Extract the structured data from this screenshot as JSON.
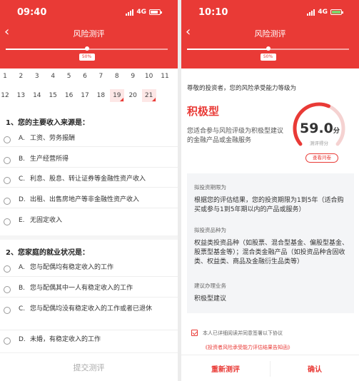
{
  "left": {
    "status": {
      "time": "09:40",
      "network": "4G"
    },
    "nav": {
      "back_label": "‹",
      "title": "风险测评"
    },
    "progress": {
      "percent": 50,
      "label": "50%"
    },
    "question_numbers": [
      {
        "n": "1",
        "answered": false
      },
      {
        "n": "2",
        "answered": false
      },
      {
        "n": "3",
        "answered": false
      },
      {
        "n": "4",
        "answered": false
      },
      {
        "n": "5",
        "answered": false
      },
      {
        "n": "6",
        "answered": false
      },
      {
        "n": "7",
        "answered": false
      },
      {
        "n": "8",
        "answered": false
      },
      {
        "n": "9",
        "answered": false
      },
      {
        "n": "10",
        "answered": false
      },
      {
        "n": "11",
        "answered": false
      },
      {
        "n": "12",
        "answered": false
      },
      {
        "n": "13",
        "answered": false
      },
      {
        "n": "14",
        "answered": false
      },
      {
        "n": "15",
        "answered": false
      },
      {
        "n": "16",
        "answered": false
      },
      {
        "n": "17",
        "answered": false
      },
      {
        "n": "18",
        "answered": false
      },
      {
        "n": "19",
        "answered": true
      },
      {
        "n": "20",
        "answered": false
      },
      {
        "n": "21",
        "answered": true
      }
    ],
    "questions": [
      {
        "title": "1、您的主要收入来源是：",
        "options": [
          {
            "letter": "A.",
            "text": "工资、劳务报酬"
          },
          {
            "letter": "B.",
            "text": "生产经营所得"
          },
          {
            "letter": "C.",
            "text": "利息、股息、转让证券等金融性资产收入"
          },
          {
            "letter": "D.",
            "text": "出租、出售房地产等非金融性资产收入"
          },
          {
            "letter": "E.",
            "text": "无固定收入"
          }
        ]
      },
      {
        "title": "2、您家庭的就业状况是：",
        "options": [
          {
            "letter": "A.",
            "text": "您与配偶均有稳定收入的工作"
          },
          {
            "letter": "B.",
            "text": "您与配偶其中一人有稳定收入的工作"
          },
          {
            "letter": "C.",
            "text": "您与配偶均没有稳定收入的工作或者已退休"
          },
          {
            "letter": "D.",
            "text": "未婚，有稳定收入的工作"
          }
        ]
      }
    ],
    "submit_label": "提交测评"
  },
  "right": {
    "status": {
      "time": "10:10",
      "network": "4G"
    },
    "nav": {
      "back_label": "‹",
      "title": "风险测评"
    },
    "progress": {
      "percent": 50,
      "label": "50%"
    },
    "greeting": "尊敬的投资者，您的风险承受能力等级为",
    "level": "积极型",
    "suitable_text": "您适合参与风险评级为积极型建议的金融产品或金融服务",
    "score": {
      "value": "59.0",
      "unit": "分",
      "label": "测评得分",
      "max": 100
    },
    "review_label": "查看问卷",
    "details": {
      "term_label": "拟投资期限为",
      "term_value": "根据您的评估结果，您的投资期限为1到5年（适合购买或参与1到5年期以内的产品或服务）",
      "type_label": "拟投资品种为",
      "type_value": "权益类投资品种（如股票、混合型基金、偏股型基金、股票型基金等）；混合类金融产品（如投资品种含固收类、权益类、商品及金融衍生品类等）",
      "service_label": "建议办理业务",
      "service_value": "积极型建议"
    },
    "agreement": {
      "text": "本人已详细阅读并同意签署以下协议",
      "link": "《投资者风险承受能力评估结果告知函》"
    },
    "buttons": {
      "retest": "重新测评",
      "confirm": "确认"
    }
  },
  "colors": {
    "brand": "#e93a36",
    "panel": "#f4f5f7"
  }
}
